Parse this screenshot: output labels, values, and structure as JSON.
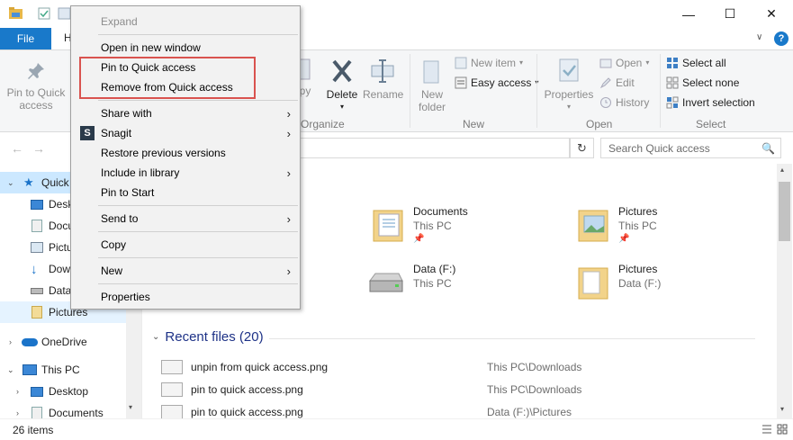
{
  "window": {
    "minimize": "—",
    "maximize": "☐",
    "close": "✕"
  },
  "ribbon_tabs": {
    "file": "File",
    "home_partial": "H",
    "help": "?",
    "collapse": "∨"
  },
  "ribbon": {
    "pin": "Pin to Quick access",
    "copy_partial": "py",
    "delete": "Delete",
    "rename": "Rename",
    "organize": "Organize",
    "new_folder": "New folder",
    "new_item": "New item",
    "easy_access": "Easy access",
    "new_group": "New",
    "properties": "Properties",
    "open": "Open",
    "edit": "Edit",
    "history": "History",
    "open_group": "Open",
    "select_all": "Select all",
    "select_none": "Select none",
    "invert_selection": "Invert selection",
    "select_group": "Select"
  },
  "address": {
    "search_placeholder": "Search Quick access",
    "refresh": "↻"
  },
  "nav": {
    "items": [
      {
        "label": "Quick"
      },
      {
        "label": "Desk"
      },
      {
        "label": "Docu"
      },
      {
        "label": "Pictu"
      },
      {
        "label": "Dow"
      },
      {
        "label": "Data"
      },
      {
        "label": "Pictures"
      },
      {
        "label": "OneDrive"
      },
      {
        "label": "This PC"
      },
      {
        "label": "Desktop"
      },
      {
        "label": "Documents"
      }
    ]
  },
  "frequent": [
    {
      "name": "Documents",
      "sub": "This PC"
    },
    {
      "name": "Pictures",
      "sub": "This PC"
    },
    {
      "name": "Data (F:)",
      "sub": "This PC"
    },
    {
      "name": "Pictures",
      "sub": "Data (F:)"
    }
  ],
  "recent": {
    "header": "Recent files (20)",
    "rows": [
      {
        "name": "unpin from quick access.png",
        "path": "This PC\\Downloads"
      },
      {
        "name": "pin to quick access.png",
        "path": "This PC\\Downloads"
      },
      {
        "name": "pin to quick access.png",
        "path": "Data (F:)\\Pictures"
      }
    ]
  },
  "status": {
    "items": "26 items"
  },
  "context_menu": {
    "expand": "Expand",
    "open_new_window": "Open in new window",
    "pin_quick": "Pin to Quick access",
    "remove_quick": "Remove from Quick access",
    "share_with": "Share with",
    "snagit": "Snagit",
    "restore": "Restore previous versions",
    "include_library": "Include in library",
    "pin_start": "Pin to Start",
    "send_to": "Send to",
    "copy": "Copy",
    "new": "New",
    "properties": "Properties"
  },
  "colors": {
    "accent": "#1979ca",
    "highlight": "#d9534f",
    "selection": "#cce8ff"
  }
}
